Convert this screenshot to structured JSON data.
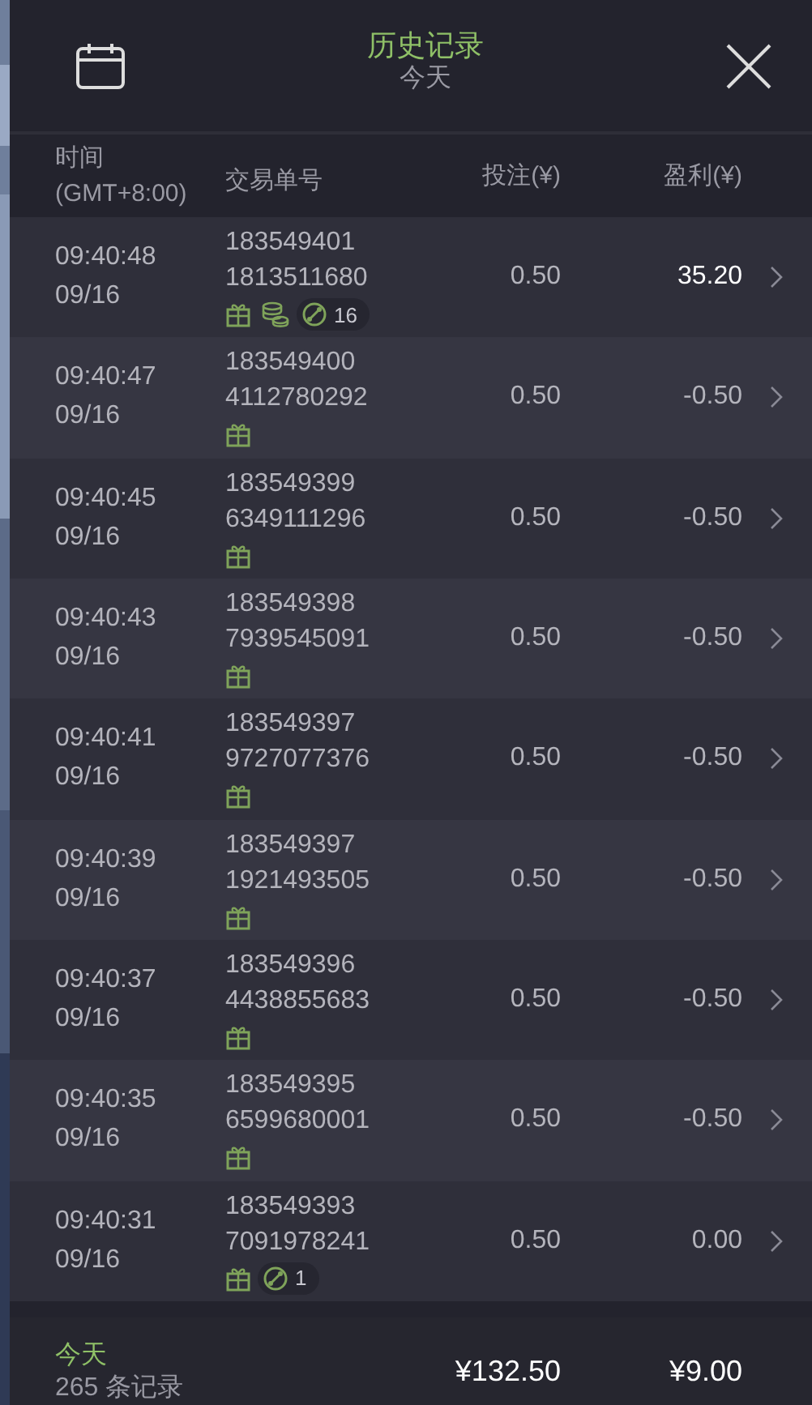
{
  "header": {
    "title": "历史记录",
    "subtitle": "今天"
  },
  "columns": [
    {
      "label": "时间\n(GMT+8:00)"
    },
    {
      "label": "交易单号"
    },
    {
      "label": "投注(¥)"
    },
    {
      "label": "盈利(¥)"
    }
  ],
  "rows": [
    {
      "time": "09:40:48",
      "date": "09/16",
      "order_1": "183549401",
      "order_2": "1813511680",
      "bet": "0.50",
      "profit": "35.20",
      "highlight": true,
      "tags": [
        {
          "kind": "gift"
        },
        {
          "kind": "coins"
        },
        {
          "kind": "spins",
          "count": "16"
        }
      ]
    },
    {
      "time": "09:40:47",
      "date": "09/16",
      "order_1": "183549400",
      "order_2": "4112780292",
      "bet": "0.50",
      "profit": "-0.50",
      "highlight": false,
      "tags": [
        {
          "kind": "gift"
        }
      ]
    },
    {
      "time": "09:40:45",
      "date": "09/16",
      "order_1": "183549399",
      "order_2": "6349111296",
      "bet": "0.50",
      "profit": "-0.50",
      "highlight": false,
      "tags": [
        {
          "kind": "gift"
        }
      ]
    },
    {
      "time": "09:40:43",
      "date": "09/16",
      "order_1": "183549398",
      "order_2": "7939545091",
      "bet": "0.50",
      "profit": "-0.50",
      "highlight": false,
      "tags": [
        {
          "kind": "gift"
        }
      ]
    },
    {
      "time": "09:40:41",
      "date": "09/16",
      "order_1": "183549397",
      "order_2": "9727077376",
      "bet": "0.50",
      "profit": "-0.50",
      "highlight": false,
      "tags": [
        {
          "kind": "gift"
        }
      ]
    },
    {
      "time": "09:40:39",
      "date": "09/16",
      "order_1": "183549397",
      "order_2": "1921493505",
      "bet": "0.50",
      "profit": "-0.50",
      "highlight": false,
      "tags": [
        {
          "kind": "gift"
        }
      ]
    },
    {
      "time": "09:40:37",
      "date": "09/16",
      "order_1": "183549396",
      "order_2": "4438855683",
      "bet": "0.50",
      "profit": "-0.50",
      "highlight": false,
      "tags": [
        {
          "kind": "gift"
        }
      ]
    },
    {
      "time": "09:40:35",
      "date": "09/16",
      "order_1": "183549395",
      "order_2": "6599680001",
      "bet": "0.50",
      "profit": "-0.50",
      "highlight": false,
      "tags": [
        {
          "kind": "gift"
        }
      ]
    },
    {
      "time": "09:40:31",
      "date": "09/16",
      "order_1": "183549393",
      "order_2": "7091978241",
      "bet": "0.50",
      "profit": "0.00",
      "highlight": false,
      "tags": [
        {
          "kind": "gift"
        },
        {
          "kind": "spins",
          "count": "1"
        }
      ]
    }
  ],
  "footer": {
    "period": "今天",
    "count": "265 条记录",
    "total_bet": "¥132.50",
    "total_profit": "¥9.00"
  }
}
